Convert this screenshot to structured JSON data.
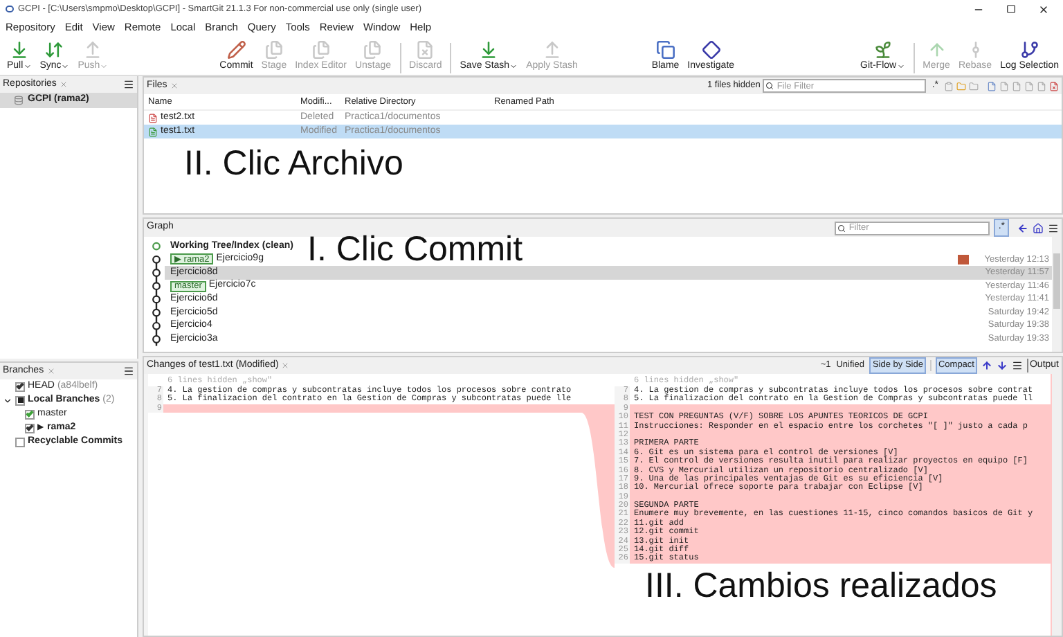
{
  "window": {
    "title": "GCPI - [C:\\Users\\smpmo\\Desktop\\GCPI] - SmartGit 21.1.3 For non-commercial use only (single user)"
  },
  "menu": [
    "Repository",
    "Edit",
    "View",
    "Remote",
    "Local",
    "Branch",
    "Query",
    "Tools",
    "Review",
    "Window",
    "Help"
  ],
  "toolbar": {
    "left": [
      {
        "label": "Pull",
        "dropdown": true,
        "disabled": false
      },
      {
        "label": "Sync",
        "dropdown": true,
        "disabled": false
      },
      {
        "label": "Push",
        "dropdown": true,
        "disabled": true
      }
    ],
    "center": [
      {
        "label": "Commit",
        "dropdown": false,
        "disabled": false
      },
      {
        "label": "Stage",
        "dropdown": false,
        "disabled": true
      },
      {
        "label": "Index Editor",
        "dropdown": false,
        "disabled": true
      },
      {
        "label": "Unstage",
        "dropdown": false,
        "disabled": true
      },
      {
        "label": "Discard",
        "dropdown": false,
        "disabled": true
      },
      {
        "label": "Save Stash",
        "dropdown": true,
        "disabled": false
      },
      {
        "label": "Apply Stash",
        "dropdown": false,
        "disabled": true
      }
    ],
    "right": [
      {
        "label": "Blame",
        "dropdown": false,
        "disabled": false
      },
      {
        "label": "Investigate",
        "dropdown": false,
        "disabled": false
      },
      {
        "label": "Git-Flow",
        "dropdown": true,
        "disabled": false
      },
      {
        "label": "Merge",
        "dropdown": false,
        "disabled": true
      },
      {
        "label": "Rebase",
        "dropdown": false,
        "disabled": true
      },
      {
        "label": "Log Selection",
        "dropdown": false,
        "disabled": false
      }
    ]
  },
  "repositories": {
    "title": "Repositories",
    "items": [
      {
        "label": "GCPI (rama2)",
        "selected": true
      }
    ]
  },
  "branches": {
    "title": "Branches",
    "items": [
      {
        "label": "HEAD",
        "detail": "(a84lbelf)",
        "checked": true,
        "color": "#333333"
      },
      {
        "label": "Local Branches",
        "detail": "(2)",
        "checked": true,
        "partial": true,
        "expanded": true,
        "children": [
          {
            "label": "master",
            "checked": true,
            "current": false,
            "color": "#3fa33a"
          },
          {
            "label": "rama2",
            "marker": "▶",
            "checked": true,
            "current": true,
            "color": "#333333"
          }
        ]
      },
      {
        "label": "Recyclable Commits",
        "checked": false
      }
    ]
  },
  "files": {
    "tab": "Files",
    "hidden_note": "1 files hidden",
    "filter_placeholder": "File Filter",
    "regex": ".*",
    "columns": [
      "Name",
      "Modifi...",
      "Relative Directory",
      "Renamed Path"
    ],
    "rows": [
      {
        "name": "test2.txt",
        "status": "Deleted",
        "directory": "Practica1/documentos",
        "kind": "deleted",
        "selected": false
      },
      {
        "name": "test1.txt",
        "status": "Modified",
        "directory": "Practica1/documentos",
        "kind": "modified",
        "selected": true
      }
    ]
  },
  "graph": {
    "title": "Graph",
    "filter_placeholder": "Filter",
    "regex": ".*",
    "rows": [
      {
        "message": "Working Tree/Index (clean)",
        "kind": "working_tree",
        "selected": false
      },
      {
        "message": "Ejercicio9g",
        "kind": "commit",
        "branch": {
          "name": "rama2",
          "marker": "▶"
        },
        "avatar": true,
        "date": "Yesterday 12:13",
        "selected": false
      },
      {
        "message": "Ejercicio8d",
        "kind": "commit",
        "date": "Yesterday 11:57",
        "selected": true
      },
      {
        "message": "Ejercicio7c",
        "kind": "commit",
        "branch": {
          "name": "master"
        },
        "date": "Yesterday 11:46",
        "selected": false
      },
      {
        "message": "Ejercicio6d",
        "kind": "commit",
        "date": "Yesterday 11:41",
        "selected": false
      },
      {
        "message": "Ejercicio5d",
        "kind": "commit",
        "date": "Saturday 19:42",
        "selected": false
      },
      {
        "message": "Ejercicio4",
        "kind": "commit",
        "date": "Saturday 19:38",
        "selected": false
      },
      {
        "message": "Ejercicio3a",
        "kind": "commit",
        "date": "Saturday 19:33",
        "selected": false
      }
    ]
  },
  "changes": {
    "title": "Changes of test1.txt (Modified)",
    "change_count": "~1",
    "views": [
      {
        "label": "Unified",
        "selected": false
      },
      {
        "label": "Side by Side",
        "selected": true
      }
    ],
    "compact": {
      "label": "Compact",
      "on": true
    },
    "output": "Output",
    "left": {
      "hidden_note": "6 lines hidden „show\"",
      "lines": [
        {
          "number": "7",
          "text": "4. La gestion de compras y subcontratas incluye todos los procesos sobre contrato",
          "kind": "context"
        },
        {
          "number": "8",
          "text": "5. La finalizacion del contrato en la Gestion de Compras y subcontratas puede lle",
          "kind": "context"
        },
        {
          "number": "9",
          "kind": "removed"
        }
      ]
    },
    "right": {
      "hidden_note": "6 lines hidden „show\"",
      "lines": [
        {
          "number": "7",
          "text": "4. La gestion de compras y subcontratas incluye todos los procesos sobre contrat",
          "kind": "context"
        },
        {
          "number": "8",
          "text": "5. La finalizacion del contrato en la Gestion de Compras y subcontratas puede ll",
          "kind": "context"
        },
        {
          "number": "9",
          "kind": "added"
        },
        {
          "number": "10",
          "text": "TEST CON PREGUNTAS (V/F) SOBRE LOS APUNTES TEORICOS DE GCPI",
          "kind": "added"
        },
        {
          "number": "11",
          "text": "Instrucciones: Responder en el espacio entre los corchetes \"[ ]\" justo a cada p",
          "kind": "added"
        },
        {
          "number": "12",
          "kind": "added"
        },
        {
          "number": "13",
          "text": "PRIMERA PARTE",
          "kind": "added"
        },
        {
          "number": "14",
          "text": "6. Git es un sistema para el control de versiones [V]",
          "kind": "added"
        },
        {
          "number": "15",
          "text": "7. El control de versiones resulta inutil para realizar proyectos en equipo [F]",
          "kind": "added"
        },
        {
          "number": "16",
          "text": "8. CVS y Mercurial utilizan un repositorio centralizado [V]",
          "kind": "added"
        },
        {
          "number": "17",
          "text": "9. Una de las principales ventajas de Git es su eficiencia [V]",
          "kind": "added"
        },
        {
          "number": "18",
          "text": "10. Mercurial ofrece soporte para trabajar con Eclipse [V]",
          "kind": "added"
        },
        {
          "number": "19",
          "kind": "added"
        },
        {
          "number": "20",
          "text": "SEGUNDA PARTE",
          "kind": "added"
        },
        {
          "number": "21",
          "text": "Enumere muy brevemente, en las cuestiones 11-15, cinco comandos basicos de Git y",
          "kind": "added"
        },
        {
          "number": "22",
          "text": "11.git add",
          "kind": "added"
        },
        {
          "number": "23",
          "text": "12.git commit",
          "kind": "added"
        },
        {
          "number": "24",
          "text": "13.git init",
          "kind": "added"
        },
        {
          "number": "25",
          "text": "14.git diff",
          "kind": "added"
        },
        {
          "number": "26",
          "text": "15.git status",
          "kind": "added"
        }
      ]
    }
  },
  "annotations": [
    {
      "text": "II. Clic Archivo"
    },
    {
      "text": "I. Clic Commit"
    },
    {
      "text": "III. Cambios realizados"
    }
  ]
}
